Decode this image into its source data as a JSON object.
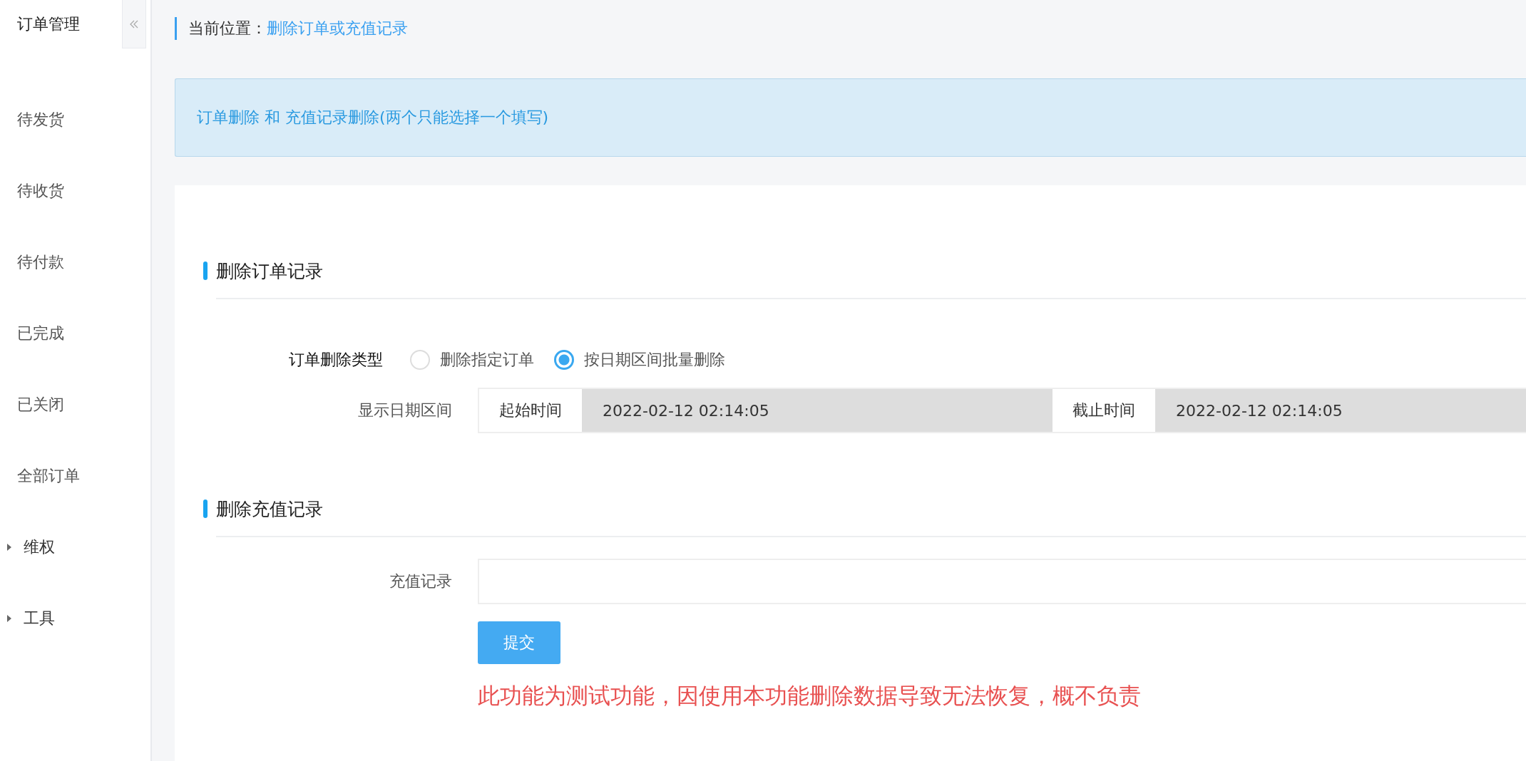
{
  "sidebar": {
    "title": "订单管理",
    "items": [
      {
        "label": "待发货",
        "kind": "link"
      },
      {
        "label": "待收货",
        "kind": "link"
      },
      {
        "label": "待付款",
        "kind": "link"
      },
      {
        "label": "已完成",
        "kind": "link"
      },
      {
        "label": "已关闭",
        "kind": "link"
      },
      {
        "label": "全部订单",
        "kind": "link"
      },
      {
        "label": "维权",
        "kind": "group",
        "expanded": false
      },
      {
        "label": "工具",
        "kind": "group",
        "expanded": false
      }
    ]
  },
  "breadcrumb": {
    "label": "当前位置：",
    "current": "删除订单或充值记录"
  },
  "notice": "订单删除 和 充值记录删除(两个只能选择一个填写)",
  "order_section": {
    "title": "删除订单记录",
    "type_label": "订单删除类型",
    "options": [
      {
        "label": "删除指定订单",
        "selected": false
      },
      {
        "label": "按日期区间批量删除",
        "selected": true
      }
    ],
    "date_label": "显示日期区间",
    "start_label": "起始时间",
    "start_value": "2022-02-12 02:14:05",
    "end_label": "截止时间",
    "end_value": "2022-02-12 02:14:05"
  },
  "recharge_section": {
    "title": "删除充值记录",
    "field_label": "充值记录"
  },
  "submit": "提交",
  "warning": "此功能为测试功能，因使用本功能删除数据导致无法恢复，概不负责"
}
